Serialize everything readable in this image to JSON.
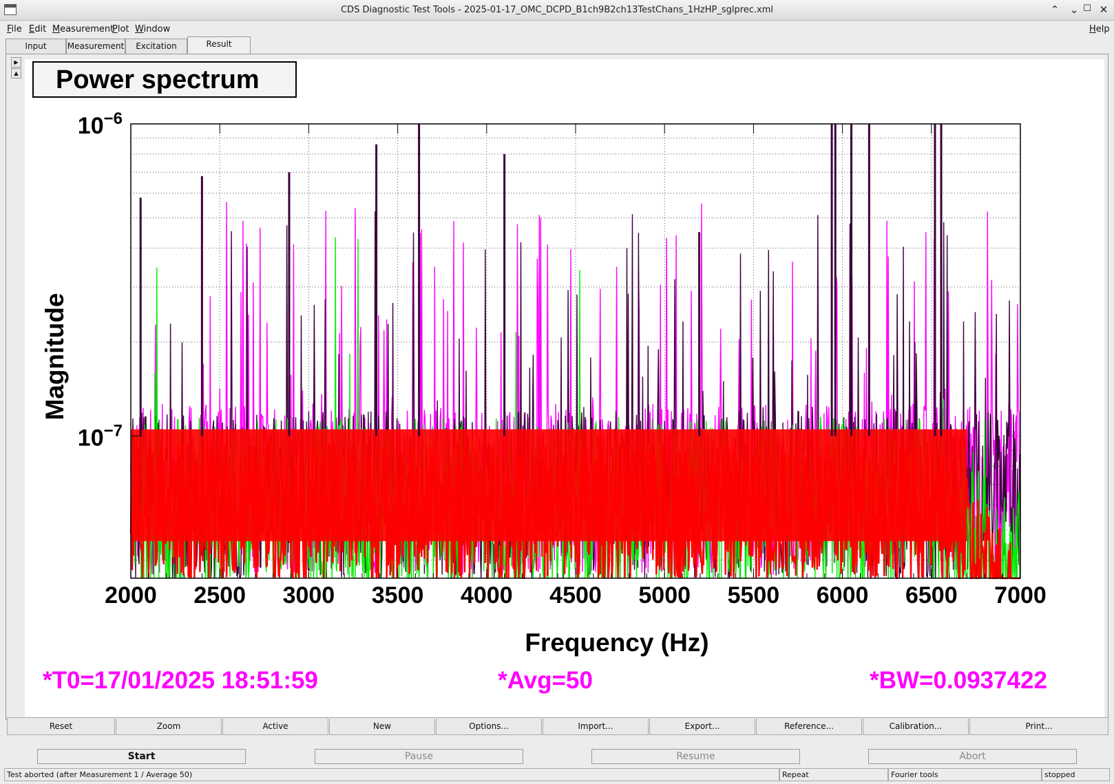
{
  "window": {
    "title": "CDS Diagnostic Test Tools - 2025-01-17_OMC_DCPD_B1ch9B2ch13TestChans_1HzHP_sglprec.xml",
    "controls": [
      "minimize-icon",
      "maximize-icon",
      "restore-icon",
      "close-icon"
    ]
  },
  "menu": {
    "file": "File",
    "edit": "Edit",
    "measurement": "Measurement",
    "plot": "Plot",
    "window": "Window",
    "help": "Help"
  },
  "tabs": [
    "Input",
    "Measurement",
    "Excitation",
    "Result"
  ],
  "active_tab": "Result",
  "plot": {
    "title": "Power spectrum",
    "info": {
      "t0": "*T0=17/01/2025 18:51:59",
      "avg": "*Avg=50",
      "bw": "*BW=0.0937422"
    },
    "info_color": "#ff00ff"
  },
  "chart_data": {
    "type": "line",
    "title": "Power spectrum",
    "xlabel": "Frequency (Hz)",
    "ylabel": "Magnitude",
    "xlim": [
      2000,
      7000
    ],
    "ylim": [
      3.5e-08,
      1e-06
    ],
    "yscale": "log",
    "grid": true,
    "x_ticks": [
      "2000",
      "2500",
      "3000",
      "3500",
      "4000",
      "4500",
      "5000",
      "5500",
      "6000",
      "6500",
      "7000"
    ],
    "y_ticks": [
      {
        "base": "10",
        "exp": "−6",
        "value": 1e-06
      },
      {
        "base": "10",
        "exp": "−7",
        "value": 1e-07
      }
    ],
    "series": [
      {
        "color": "#ff00ff",
        "floor": 7.2e-08,
        "spread": 0.55,
        "peak_density": 0.09
      },
      {
        "color": "#3a003a",
        "floor": 6.8e-08,
        "spread": 0.55,
        "peak_density": 0.06
      },
      {
        "color": "#00ee00",
        "floor": 6.2e-08,
        "spread": 0.6,
        "peak_density": 0.01
      },
      {
        "color": "#ff0000",
        "floor": 6e-08,
        "spread": 0.45,
        "peak_density": 0.0
      }
    ],
    "peaks": [
      {
        "x": 2055,
        "y": 5.8e-07
      },
      {
        "x": 2400,
        "y": 6.8e-07
      },
      {
        "x": 2890,
        "y": 7e-07
      },
      {
        "x": 3380,
        "y": 8.6e-07
      },
      {
        "x": 3620,
        "y": 1e-06
      },
      {
        "x": 4100,
        "y": 8e-07
      },
      {
        "x": 5195,
        "y": 4.5e-07
      },
      {
        "x": 5940,
        "y": 1e-06
      },
      {
        "x": 5960,
        "y": 1e-06
      },
      {
        "x": 6050,
        "y": 1e-06
      },
      {
        "x": 6150,
        "y": 1e-06
      },
      {
        "x": 6520,
        "y": 1e-06
      },
      {
        "x": 6555,
        "y": 1e-06
      }
    ]
  },
  "plot_buttons": [
    "Reset",
    "Zoom",
    "Active",
    "New",
    "Options...",
    "Import...",
    "Export...",
    "Reference...",
    "Calibration...",
    "Print..."
  ],
  "control_buttons": {
    "start": "Start",
    "pause": "Pause",
    "resume": "Resume",
    "abort": "Abort"
  },
  "status": {
    "message": "Test aborted (after Measurement 1 / Average 50)",
    "mode": "Repeat",
    "tool": "Fourier tools",
    "state": "stopped"
  }
}
